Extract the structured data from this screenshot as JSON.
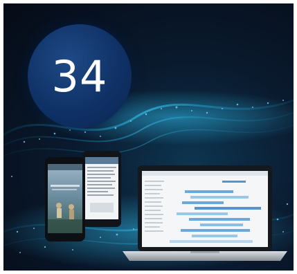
{
  "badge": {
    "number": "34"
  },
  "colors": {
    "background_dark": "#050b16",
    "wave_glow": "#2fb8e8",
    "badge_fill": "#133a75",
    "laptop_screen_bar": "#6fa7d8"
  },
  "illustration": {
    "devices": [
      "phone-front",
      "phone-back",
      "laptop"
    ]
  }
}
